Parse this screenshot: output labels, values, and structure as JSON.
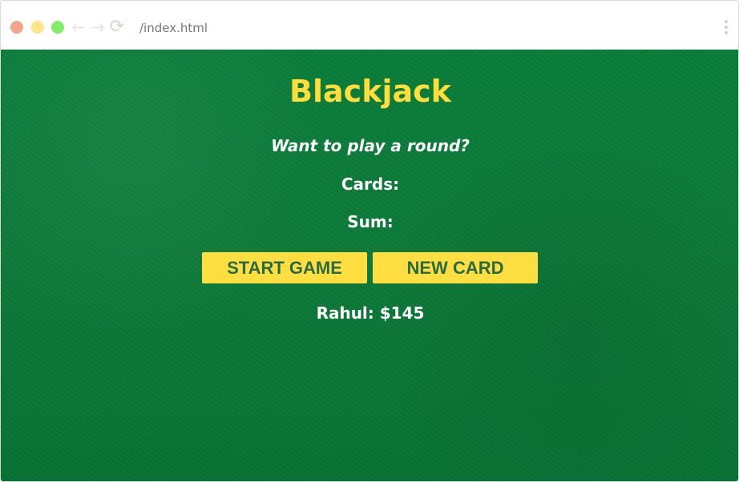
{
  "browser": {
    "url": "/index.html",
    "traffic_colors": {
      "close": "#f7a28a",
      "minimize": "#fde58a",
      "zoom": "#83ec6a"
    }
  },
  "game": {
    "title": "Blackjack",
    "message": "Want to play a round?",
    "cards_label": "Cards:",
    "sum_label": "Sum:",
    "start_button_label": "START GAME",
    "new_card_button_label": "NEW CARD",
    "player_label": "Rahul: $145",
    "colors": {
      "title": "#ffde3b",
      "button": "#ffde42",
      "button_text": "#2a6a40",
      "table": "#0b7a38"
    }
  }
}
